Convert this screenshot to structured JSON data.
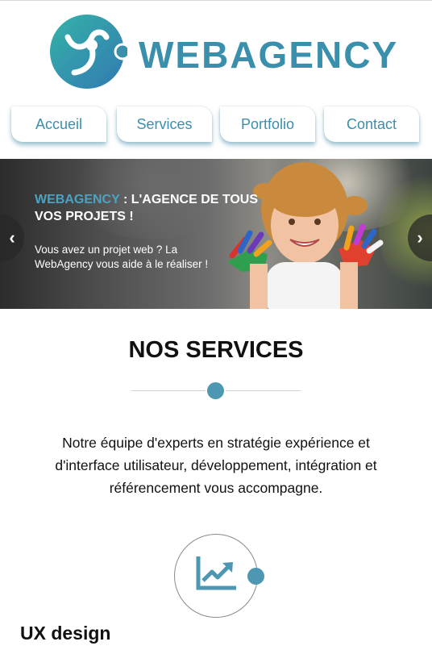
{
  "header": {
    "logo_text": "WEBAGENCY",
    "logo_icon": "webagency-logo-icon",
    "brand_color": "#3a8fac"
  },
  "nav": {
    "items": [
      {
        "label": "Accueil"
      },
      {
        "label": "Services"
      },
      {
        "label": "Portfolio"
      },
      {
        "label": "Contact"
      }
    ]
  },
  "hero": {
    "title_brand": "WEBAGENCY",
    "title_rest": " : L'AGENCE DE TOUS VOS PROJETS !",
    "text": "Vous avez un projet web ? La WebAgency vous aide à le réaliser !",
    "prev_icon": "chevron-left-icon",
    "next_icon": "chevron-right-icon",
    "prev_glyph": "‹",
    "next_glyph": "›"
  },
  "services": {
    "title": "NOS SERVICES",
    "description": "Notre équipe d'experts en stratégie expérience et d'interface utilisateur, développement, intégration et référencement vous accompagne.",
    "items": [
      {
        "title": "UX design",
        "icon": "chart-growth-icon"
      }
    ],
    "accent_color": "#4e97b3"
  }
}
